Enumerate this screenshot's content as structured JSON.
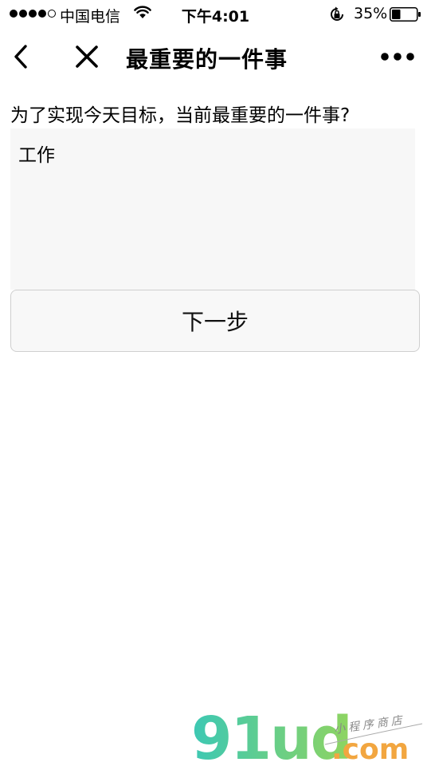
{
  "status_bar": {
    "carrier": "中国电信",
    "time": "下午4:01",
    "battery_percent": "35%",
    "battery_level": 0.35,
    "icons": [
      "signal-dots-icon",
      "wifi-icon",
      "rotation-lock-icon",
      "battery-icon"
    ]
  },
  "nav": {
    "title": "最重要的一件事",
    "icons": [
      "back-icon",
      "close-icon",
      "more-icon"
    ]
  },
  "form": {
    "question": "为了实现今天目标，当前最重要的一件事?",
    "answer_value": "工作",
    "next_label": "下一步"
  },
  "watermark": {
    "logo_text": "91ud",
    "domain_suffix": ".com",
    "tagline": "小程序商店",
    "colors": [
      "#3cc8b4",
      "#8fd460",
      "#f2a640"
    ]
  }
}
